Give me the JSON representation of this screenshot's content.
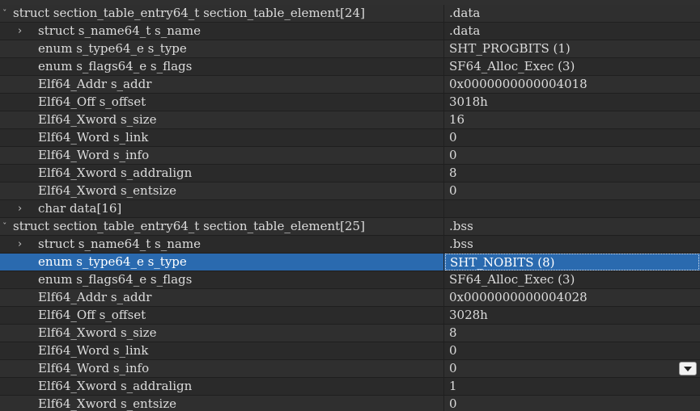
{
  "rows": [
    {
      "level": 0,
      "name": "struct section_table_entry64_t section_table_element[24]",
      "value": ".data"
    },
    {
      "level": 1,
      "expand": true,
      "name": "struct s_name64_t s_name",
      "value": ".data"
    },
    {
      "level": 1,
      "name": "enum s_type64_e s_type",
      "value": "SHT_PROGBITS (1)"
    },
    {
      "level": 1,
      "name": "enum s_flags64_e s_flags",
      "value": "SF64_Alloc_Exec (3)"
    },
    {
      "level": 1,
      "name": "Elf64_Addr s_addr",
      "value": "0x0000000000004018"
    },
    {
      "level": 1,
      "name": "Elf64_Off s_offset",
      "value": "3018h"
    },
    {
      "level": 1,
      "name": "Elf64_Xword s_size",
      "value": "16"
    },
    {
      "level": 1,
      "name": "Elf64_Word s_link",
      "value": "0"
    },
    {
      "level": 1,
      "name": "Elf64_Word s_info",
      "value": "0"
    },
    {
      "level": 1,
      "name": "Elf64_Xword s_addralign",
      "value": "8"
    },
    {
      "level": 1,
      "name": "Elf64_Xword s_entsize",
      "value": "0"
    },
    {
      "level": 1,
      "expand": true,
      "name": "char data[16]",
      "value": ""
    },
    {
      "level": 0,
      "name": "struct section_table_entry64_t section_table_element[25]",
      "value": ".bss"
    },
    {
      "level": 1,
      "expand": true,
      "name": "struct s_name64_t s_name",
      "value": ".bss"
    },
    {
      "level": 1,
      "selected": true,
      "name": "enum s_type64_e s_type",
      "value": "SHT_NOBITS (8)"
    },
    {
      "level": 1,
      "name": "enum s_flags64_e s_flags",
      "value": "SF64_Alloc_Exec (3)"
    },
    {
      "level": 1,
      "name": "Elf64_Addr s_addr",
      "value": "0x0000000000004028"
    },
    {
      "level": 1,
      "name": "Elf64_Off s_offset",
      "value": "3028h"
    },
    {
      "level": 1,
      "name": "Elf64_Xword s_size",
      "value": "8"
    },
    {
      "level": 1,
      "name": "Elf64_Word s_link",
      "value": "0"
    },
    {
      "level": 1,
      "name": "Elf64_Word s_info",
      "value": "0"
    },
    {
      "level": 1,
      "name": "Elf64_Xword s_addralign",
      "value": "1"
    },
    {
      "level": 1,
      "name": "Elf64_Xword s_entsize",
      "value": "0"
    }
  ],
  "icons": {
    "expand": "chevron-right-icon",
    "collapse": "collapse-icon",
    "dropdown": "chevron-down-icon"
  },
  "colors": {
    "background": "#2b2b2b",
    "selection": "#2a6aaf",
    "text": "#dcdcdc"
  }
}
